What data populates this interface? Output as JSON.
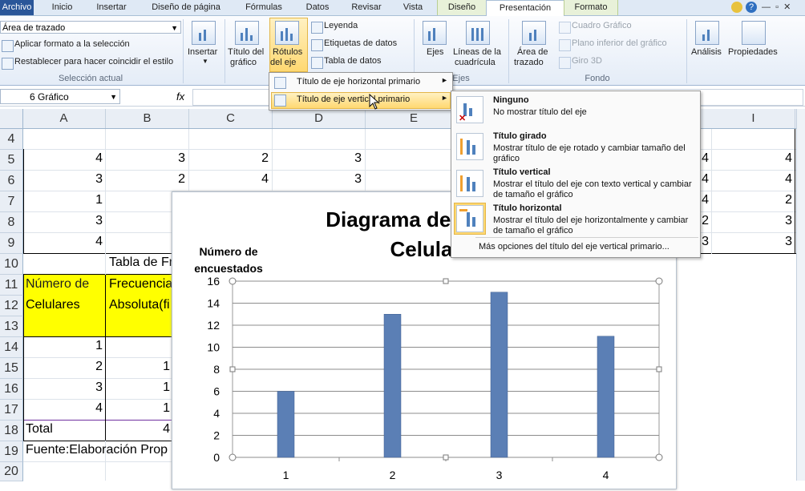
{
  "tabs": [
    "Archivo",
    "Inicio",
    "Insertar",
    "Diseño de página",
    "Fórmulas",
    "Datos",
    "Revisar",
    "Vista",
    "Diseño",
    "Presentación",
    "Formato"
  ],
  "active_tab": "Presentación",
  "ribbon": {
    "selection_combo": "Área de trazado",
    "apply_format": "Aplicar formato a la selección",
    "reset_style": "Restablecer para hacer coincidir el estilo",
    "group_selection": "Selección actual",
    "insert": "Insertar",
    "chart_title": [
      "Título del",
      "gráfico"
    ],
    "axis_titles": [
      "Rótulos",
      "del eje"
    ],
    "legend": "Leyenda",
    "data_labels": "Etiquetas de datos",
    "data_table": "Tabla de datos",
    "axes": "Ejes",
    "gridlines": [
      "Líneas de la",
      "cuadrícula"
    ],
    "group_axes": "Ejes",
    "plot_area": [
      "Área de",
      "trazado"
    ],
    "chart_wall": "Cuadro Gráfico",
    "chart_floor": "Plano inferior del gráfico",
    "rotation_3d": "Giro 3D",
    "group_background": "Fondo",
    "analysis": "Análisis",
    "properties": "Propiedades"
  },
  "formula_bar": {
    "name_box": "6 Gráfico",
    "fx": "fx"
  },
  "columns": [
    "A",
    "B",
    "C",
    "D",
    "E",
    "I"
  ],
  "rows": [
    "4",
    "5",
    "6",
    "7",
    "8",
    "9",
    "10",
    "11",
    "12",
    "13",
    "14",
    "15",
    "16",
    "17",
    "18",
    "19",
    "20"
  ],
  "sheet": {
    "rows_5_9": [
      {
        "A": "4",
        "B": "3",
        "C": "2",
        "D": "3",
        "H": "4",
        "I": "4"
      },
      {
        "A": "3",
        "B": "2",
        "C": "4",
        "D": "3",
        "H": "4",
        "I": "4"
      },
      {
        "A": "1",
        "B": "",
        "C": "",
        "D": "",
        "H": "4",
        "I": "2"
      },
      {
        "A": "3",
        "B": "",
        "C": "",
        "D": "",
        "H": "2",
        "I": "3"
      },
      {
        "A": "4",
        "B": "",
        "C": "",
        "D": "",
        "H": "3",
        "I": "3"
      }
    ],
    "table_title": "Tabla de Fr",
    "hdr_A": [
      "Número de",
      "Celulares"
    ],
    "hdr_B": [
      "Frecuencia",
      "Absoluta(fi"
    ],
    "rows_14_17": [
      {
        "A": "1",
        "B": ""
      },
      {
        "A": "2",
        "B": "1"
      },
      {
        "A": "3",
        "B": "1"
      },
      {
        "A": "4",
        "B": "1"
      }
    ],
    "total_label": "Total",
    "total_b": "4",
    "source": "Fuente:Elaboración Prop"
  },
  "menu1": {
    "items": [
      "Título de eje horizontal primario",
      "Título de eje vertical primario"
    ]
  },
  "menu2": {
    "items": [
      {
        "title": "Ninguno",
        "desc": "No mostrar título del eje"
      },
      {
        "title": "Título girado",
        "desc": "Mostrar título de eje rotado y cambiar tamaño del gráfico"
      },
      {
        "title": "Título vertical",
        "desc": "Mostrar el título del eje con texto vertical y cambiar de tamaño el gráfico"
      },
      {
        "title": "Título horizontal",
        "desc": "Mostrar el título del eje horizontalmente y cambiar de tamaño el gráfico"
      }
    ],
    "more": "Más opciones del título del eje vertical primario..."
  },
  "chart_data": {
    "type": "bar",
    "title": "Diagrama de bastones Celulares",
    "ylabel": "Número de encuestados",
    "xlabel": "",
    "categories": [
      "1",
      "2",
      "3",
      "4"
    ],
    "values": [
      6,
      13,
      15,
      11
    ],
    "ylim": [
      0,
      16
    ],
    "yticks": [
      0,
      2,
      4,
      6,
      8,
      10,
      12,
      14,
      16
    ],
    "grid": true,
    "color": "#5b7fb5"
  }
}
